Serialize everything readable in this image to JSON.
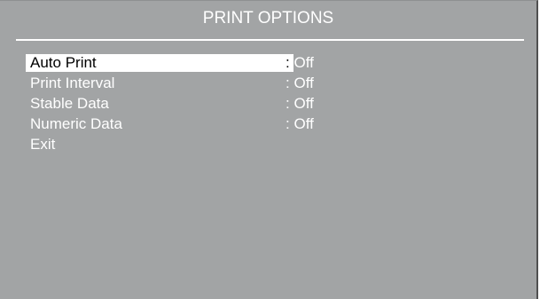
{
  "header": {
    "title": "PRINT OPTIONS"
  },
  "menu": {
    "items": [
      {
        "label": "Auto Print",
        "separator": ":",
        "value": "Off",
        "selected": true
      },
      {
        "label": "Print Interval",
        "separator": ":",
        "value": "Off",
        "selected": false
      },
      {
        "label": "Stable Data",
        "separator": ":",
        "value": "Off",
        "selected": false
      },
      {
        "label": "Numeric Data",
        "separator": ":",
        "value": "Off",
        "selected": false
      },
      {
        "label": "Exit",
        "separator": "",
        "value": "",
        "selected": false
      }
    ]
  },
  "colors": {
    "background": "#a2a4a5",
    "text": "#ffffff",
    "highlight": "#ffffff",
    "highlight_text": "#000000"
  }
}
